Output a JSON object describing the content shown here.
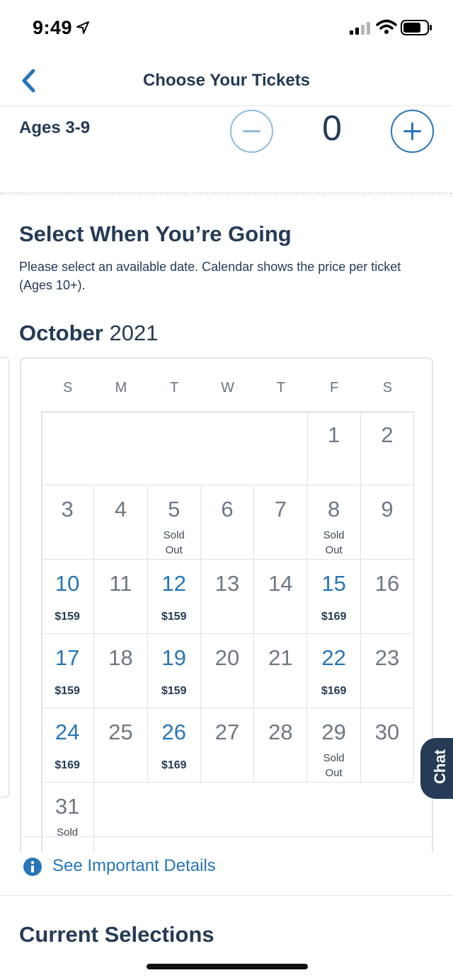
{
  "status_bar": {
    "time": "9:49",
    "icons": [
      "location-arrow-icon",
      "signal-icon",
      "wifi-icon",
      "battery-icon"
    ]
  },
  "header": {
    "title": "Choose Your Tickets",
    "back_icon": "chevron-left-icon"
  },
  "age_selector": {
    "label": "Ages 3-9",
    "count": "0",
    "minus_icon": "minus-circle-icon",
    "plus_icon": "plus-circle-icon"
  },
  "date_section": {
    "title": "Select When You’re Going",
    "description": "Please select an available date. Calendar shows the price per ticket  (Ages 10+)."
  },
  "calendar": {
    "month": "October",
    "year": "2021",
    "weekdays": [
      "S",
      "M",
      "T",
      "W",
      "T",
      "F",
      "S"
    ],
    "days": [
      {
        "day": "1",
        "note": "",
        "price": "",
        "available": false
      },
      {
        "day": "2",
        "note": "",
        "price": "",
        "available": false
      },
      {
        "day": "3",
        "note": "",
        "price": "",
        "available": false
      },
      {
        "day": "4",
        "note": "",
        "price": "",
        "available": false
      },
      {
        "day": "5",
        "note": "Sold\nOut",
        "price": "",
        "available": false
      },
      {
        "day": "6",
        "note": "",
        "price": "",
        "available": false
      },
      {
        "day": "7",
        "note": "",
        "price": "",
        "available": false
      },
      {
        "day": "8",
        "note": "Sold\nOut",
        "price": "",
        "available": false
      },
      {
        "day": "9",
        "note": "",
        "price": "",
        "available": false
      },
      {
        "day": "10",
        "note": "",
        "price": "$159",
        "available": true
      },
      {
        "day": "11",
        "note": "",
        "price": "",
        "available": false
      },
      {
        "day": "12",
        "note": "",
        "price": "$159",
        "available": true
      },
      {
        "day": "13",
        "note": "",
        "price": "",
        "available": false
      },
      {
        "day": "14",
        "note": "",
        "price": "",
        "available": false
      },
      {
        "day": "15",
        "note": "",
        "price": "$169",
        "available": true
      },
      {
        "day": "16",
        "note": "",
        "price": "",
        "available": false
      },
      {
        "day": "17",
        "note": "",
        "price": "$159",
        "available": true
      },
      {
        "day": "18",
        "note": "",
        "price": "",
        "available": false
      },
      {
        "day": "19",
        "note": "",
        "price": "$159",
        "available": true
      },
      {
        "day": "20",
        "note": "",
        "price": "",
        "available": false
      },
      {
        "day": "21",
        "note": "",
        "price": "",
        "available": false
      },
      {
        "day": "22",
        "note": "",
        "price": "$169",
        "available": true
      },
      {
        "day": "23",
        "note": "",
        "price": "",
        "available": false
      },
      {
        "day": "24",
        "note": "",
        "price": "$169",
        "available": true
      },
      {
        "day": "25",
        "note": "",
        "price": "",
        "available": false
      },
      {
        "day": "26",
        "note": "",
        "price": "$169",
        "available": true
      },
      {
        "day": "27",
        "note": "",
        "price": "",
        "available": false
      },
      {
        "day": "28",
        "note": "",
        "price": "",
        "available": false
      },
      {
        "day": "29",
        "note": "Sold\nOut",
        "price": "",
        "available": false
      },
      {
        "day": "30",
        "note": "",
        "price": "",
        "available": false
      },
      {
        "day": "31",
        "note": "Sold",
        "price": "",
        "available": false
      }
    ]
  },
  "chat": {
    "label": "Chat"
  },
  "details": {
    "label": "See Important Details",
    "icon": "info-circle-icon"
  },
  "current": {
    "title": "Current Selections"
  },
  "colors": {
    "navy": "#253b56",
    "link_blue": "#2776b7",
    "disabled_blue": "#8fbcda",
    "grid_line": "#dfe2e6"
  }
}
